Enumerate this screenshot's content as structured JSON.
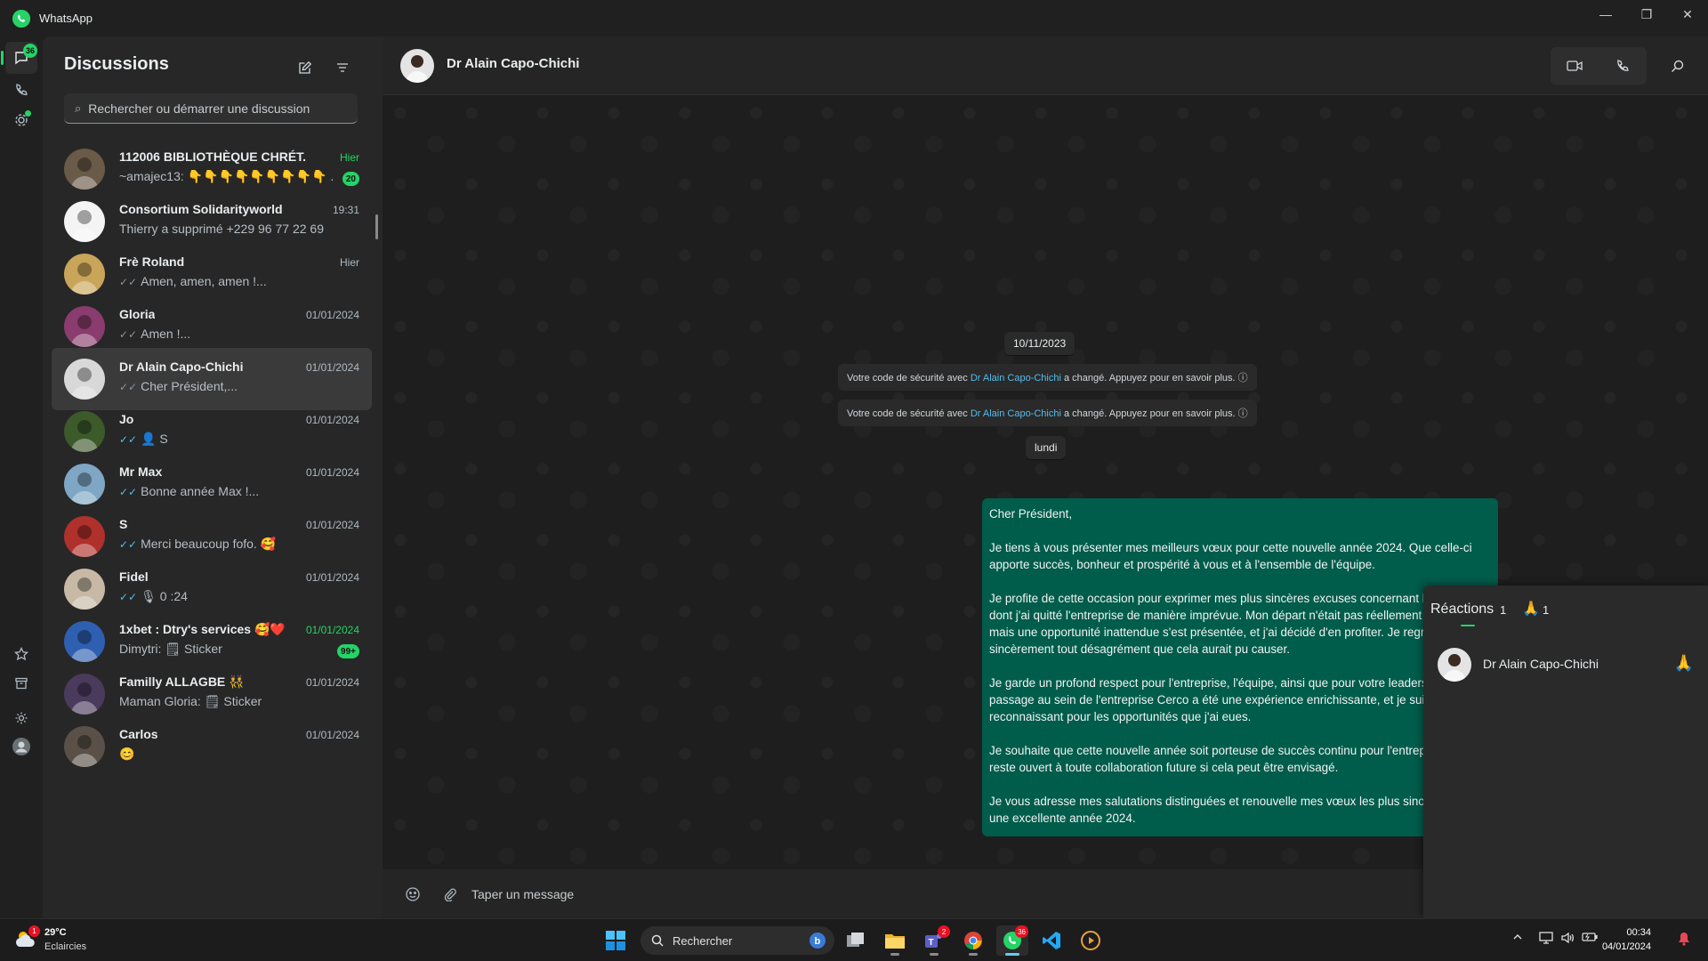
{
  "window": {
    "title": "WhatsApp",
    "controls": [
      "—",
      "❐",
      "✕"
    ]
  },
  "rail": {
    "chats_badge": "36"
  },
  "list": {
    "title": "Discussions",
    "search_placeholder": "Rechercher ou démarrer une discussion",
    "chats": [
      {
        "name": "112006 BIBLIOTHÈQUE CHRÉT.",
        "preview": "~amajec13: 👇👇👇👇👇👇👇👇👇 ...",
        "time": "Hier",
        "unread": "20",
        "ticks": "",
        "avatar_color": "#6a5a48"
      },
      {
        "name": "Consortium Solidarityworld",
        "preview": "Thierry a supprimé +229 96 77 22 69",
        "time": "19:31",
        "unread": "",
        "ticks": "",
        "avatar_color": "#f4f4f4"
      },
      {
        "name": "Frè Roland",
        "preview": "Amen, amen, amen !...",
        "time": "Hier",
        "unread": "",
        "ticks": "✓✓",
        "avatar_color": "#c9a55a"
      },
      {
        "name": "Gloria",
        "preview": "Amen !...",
        "time": "01/01/2024",
        "unread": "",
        "ticks": "✓✓",
        "avatar_color": "#8a3c6e"
      },
      {
        "name": "Dr Alain Capo-Chichi",
        "preview": "Cher Président,...",
        "time": "01/01/2024",
        "unread": "",
        "ticks": "✓✓",
        "avatar_color": "#d8d8d8"
      },
      {
        "name": "Jo",
        "preview": "👤 S",
        "time": "01/01/2024",
        "unread": "",
        "ticks": "✓✓",
        "avatar_color": "#3c5a2a"
      },
      {
        "name": "Mr Max",
        "preview": "Bonne année Max !...",
        "time": "01/01/2024",
        "unread": "",
        "ticks": "✓✓",
        "avatar_color": "#7fa6c4"
      },
      {
        "name": "S",
        "preview": "Merci beaucoup fofo. 🥰",
        "time": "01/01/2024",
        "unread": "",
        "ticks": "✓✓",
        "avatar_color": "#b0302c"
      },
      {
        "name": "Fidel",
        "preview": "🎙 0 :24",
        "time": "01/01/2024",
        "unread": "",
        "ticks": "✓✓",
        "avatar_color": "#c7b9a6"
      },
      {
        "name": "1xbet : Dtry's services 🥰❤️",
        "preview": "Dimytri: 🗒 Sticker",
        "time": "01/01/2024",
        "unread": "99+",
        "ticks": "",
        "avatar_color": "#2f5fb0"
      },
      {
        "name": "Familly ALLAGBE 👯",
        "preview": "Maman Gloria: 🗒 Sticker",
        "time": "01/01/2024",
        "unread": "",
        "ticks": "",
        "avatar_color": "#4a3a5c"
      },
      {
        "name": "Carlos",
        "preview": "😊",
        "time": "01/01/2024",
        "unread": "",
        "ticks": "",
        "avatar_color": "#5a5048"
      }
    ]
  },
  "conversation": {
    "contact_name": "Dr Alain Capo-Chichi",
    "date_pill": "10/11/2023",
    "system_messages": [
      {
        "before": "Votre code de sécurité avec ",
        "link": "Dr Alain Capo-Chichi",
        "after": " a changé. Appuyez pour en savoir plus. ⓘ"
      },
      {
        "before": "Votre code de sécurité avec ",
        "link": "Dr Alain Capo-Chichi",
        "after": " a changé. Appuyez pour en savoir plus. ⓘ"
      }
    ],
    "day_pill": "lundi",
    "message_paragraphs": [
      "Cher Président,",
      "Je tiens à vous présenter mes meilleurs vœux pour cette nouvelle année 2024. Que celle-ci apporte succès, bonheur et prospérité à vous et à l'ensemble de l'équipe.",
      "Je profite de cette occasion pour exprimer mes plus sincères excuses concernant la manière dont j'ai quitté l'entreprise de manière imprévue. Mon départ n'était pas réellement planifié, mais une opportunité inattendue s'est présentée, et j'ai décidé d'en profiter. Je regrette sincèrement tout désagrément que cela aurait pu causer.",
      "Je garde un profond respect pour l'entreprise, l'équipe, ainsi que pour votre leadership. Mon passage au sein de l'entreprise Cerco a été une expérience enrichissante, et je suis reconnaissant pour les opportunités que j'ai eues.",
      "Je souhaite que cette nouvelle année soit porteuse de succès continu pour l'entreprise, et je reste ouvert à toute collaboration future si cela peut être envisagé.",
      "Je vous adresse mes salutations distinguées et renouvelle mes vœux les plus sincères pour une excellente année 2024."
    ],
    "composer_placeholder": "Taper un message"
  },
  "reactions": {
    "title": "Réactions",
    "total": "1",
    "emoji": "🙏",
    "emoji_count": "1",
    "user": "Dr Alain Capo-Chichi",
    "user_emoji": "🙏"
  },
  "taskbar": {
    "weather_temp": "29°C",
    "weather_cond": "Eclaircies",
    "weather_badge": "1",
    "search_label": "Rechercher",
    "teams_badge": "2",
    "whatsapp_badge": "36",
    "time": "00:34",
    "date": "04/01/2024"
  },
  "colors": {
    "accent": "#25d366",
    "bubble_out": "#005c4b",
    "link": "#53bdeb"
  }
}
